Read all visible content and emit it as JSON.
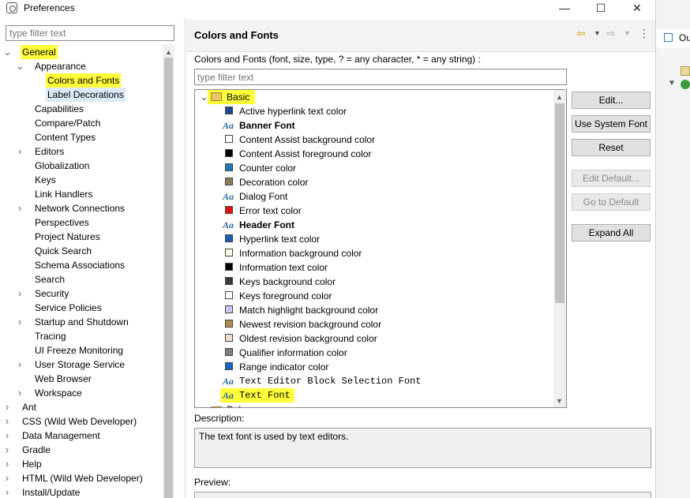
{
  "window": {
    "title": "Preferences",
    "minimize": "—",
    "maximize": "☐",
    "close": "✕"
  },
  "left": {
    "filter_placeholder": "type filter text",
    "tree": [
      {
        "label": "General",
        "level": 0,
        "expanded": true,
        "highlight": true
      },
      {
        "label": "Appearance",
        "level": 1,
        "expanded": true
      },
      {
        "label": "Colors and Fonts",
        "level": 2,
        "highlight": true,
        "selected": true
      },
      {
        "label": "Label Decorations",
        "level": 2,
        "selected_light": true
      },
      {
        "label": "Capabilities",
        "level": 1
      },
      {
        "label": "Compare/Patch",
        "level": 1
      },
      {
        "label": "Content Types",
        "level": 1
      },
      {
        "label": "Editors",
        "level": 1,
        "collapsed": true
      },
      {
        "label": "Globalization",
        "level": 1
      },
      {
        "label": "Keys",
        "level": 1
      },
      {
        "label": "Link Handlers",
        "level": 1
      },
      {
        "label": "Network Connections",
        "level": 1,
        "collapsed": true
      },
      {
        "label": "Perspectives",
        "level": 1
      },
      {
        "label": "Project Natures",
        "level": 1
      },
      {
        "label": "Quick Search",
        "level": 1
      },
      {
        "label": "Schema Associations",
        "level": 1
      },
      {
        "label": "Search",
        "level": 1
      },
      {
        "label": "Security",
        "level": 1,
        "collapsed": true
      },
      {
        "label": "Service Policies",
        "level": 1
      },
      {
        "label": "Startup and Shutdown",
        "level": 1,
        "collapsed": true
      },
      {
        "label": "Tracing",
        "level": 1
      },
      {
        "label": "UI Freeze Monitoring",
        "level": 1
      },
      {
        "label": "User Storage Service",
        "level": 1,
        "collapsed": true
      },
      {
        "label": "Web Browser",
        "level": 1
      },
      {
        "label": "Workspace",
        "level": 1,
        "collapsed": true
      },
      {
        "label": "Ant",
        "level": 0,
        "collapsed": true
      },
      {
        "label": "CSS (Wild Web Developer)",
        "level": 0,
        "collapsed": true
      },
      {
        "label": "Data Management",
        "level": 0,
        "collapsed": true
      },
      {
        "label": "Gradle",
        "level": 0,
        "collapsed": true
      },
      {
        "label": "Help",
        "level": 0,
        "collapsed": true
      },
      {
        "label": "HTML (Wild Web Developer)",
        "level": 0,
        "collapsed": true
      },
      {
        "label": "Install/Update",
        "level": 0,
        "collapsed": true
      }
    ]
  },
  "page": {
    "title": "Colors and Fonts",
    "description": "Colors and Fonts (font, size, type, ? = any character, * = any string) :",
    "filter_placeholder": "type filter text",
    "category": {
      "label": "Basic",
      "highlight": true
    },
    "items": [
      {
        "label": "Active hyperlink text color",
        "kind": "color",
        "color": "#1a4a8c"
      },
      {
        "label": "Banner Font",
        "kind": "font",
        "bold": true
      },
      {
        "label": "Content Assist background color",
        "kind": "color",
        "color": "#ffffff"
      },
      {
        "label": "Content Assist foreground color",
        "kind": "color",
        "color": "#000000"
      },
      {
        "label": "Counter color",
        "kind": "color",
        "color": "#1f7ab5"
      },
      {
        "label": "Decoration color",
        "kind": "color",
        "color": "#8a7a55"
      },
      {
        "label": "Dialog Font",
        "kind": "font"
      },
      {
        "label": "Error text color",
        "kind": "color",
        "color": "#e01010"
      },
      {
        "label": "Header Font",
        "kind": "font",
        "bold": true
      },
      {
        "label": "Hyperlink text color",
        "kind": "color",
        "color": "#1a5cb8"
      },
      {
        "label": "Information background color",
        "kind": "color",
        "color": "#fdfde0"
      },
      {
        "label": "Information text color",
        "kind": "color",
        "color": "#000000"
      },
      {
        "label": "Keys background color",
        "kind": "color",
        "color": "#3a3a3a"
      },
      {
        "label": "Keys foreground color",
        "kind": "color",
        "color": "#ffffff"
      },
      {
        "label": "Match highlight background color",
        "kind": "color",
        "color": "#c8c8f0"
      },
      {
        "label": "Newest revision background color",
        "kind": "color",
        "color": "#b08a48"
      },
      {
        "label": "Oldest revision background color",
        "kind": "color",
        "color": "#f0dcc8"
      },
      {
        "label": "Qualifier information color",
        "kind": "color",
        "color": "#808080"
      },
      {
        "label": "Range indicator color",
        "kind": "color",
        "color": "#1a66c8"
      },
      {
        "label": "Text Editor Block Selection Font",
        "kind": "font",
        "mono": true
      },
      {
        "label": "Text Font",
        "kind": "font",
        "mono": true,
        "highlight": true
      },
      {
        "label": "Debug",
        "kind": "folder"
      }
    ],
    "buttons": {
      "edit": "Edit...",
      "use_system_font": "Use System Font",
      "reset": "Reset",
      "edit_default": "Edit Default...",
      "go_to_default": "Go to Default",
      "expand_all": "Expand All"
    },
    "description_label": "Description:",
    "description_text": "The text font is used by text editors.",
    "preview_label": "Preview:"
  },
  "background_window": {
    "tab_label": "Ou"
  },
  "colors": {
    "highlight": "#ffff3a",
    "selection": "#dbe9f8",
    "accent": "#2c6aa0"
  }
}
